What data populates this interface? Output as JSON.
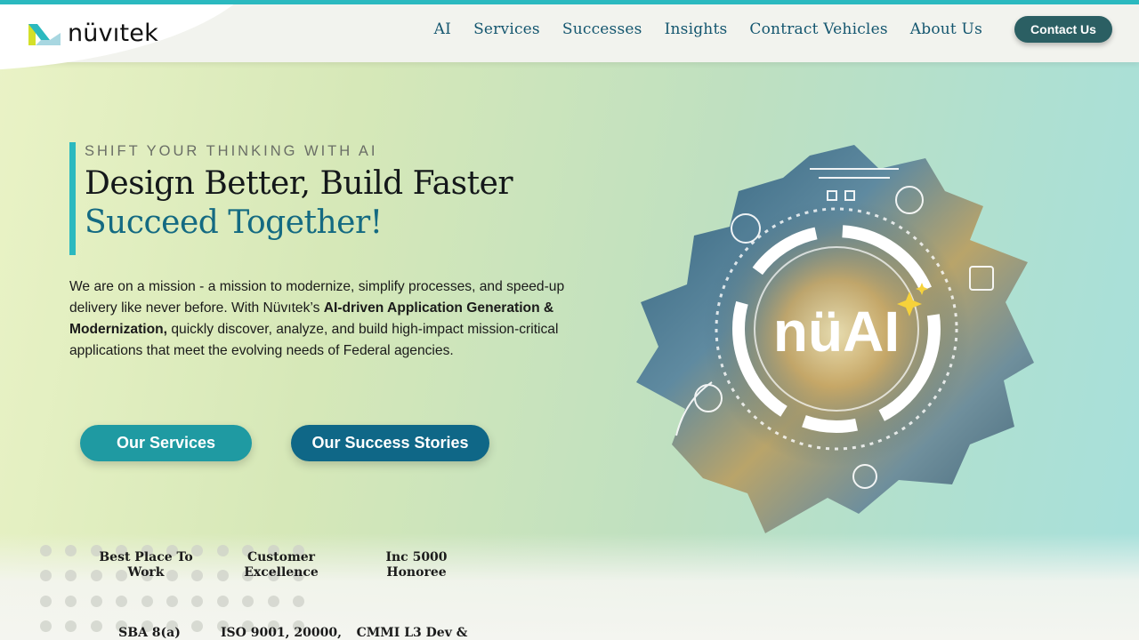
{
  "header": {
    "logo_text": "nüvıtek",
    "nav": [
      "AI",
      "Services",
      "Successes",
      "Insights",
      "Contract Vehicles",
      "About Us"
    ],
    "contact_label": "Contact Us"
  },
  "hero": {
    "eyebrow": "SHIFT YOUR THINKING WITH AI",
    "headline_1": "Design Better, Build Faster",
    "headline_2": "Succeed Together!",
    "mission_1": "We are on a mission - a mission to modernize, simplify processes, and speed-up delivery like never before. With Nüvıtek’s ",
    "mission_bold": "AI-driven Application Generation & Modernization,",
    "mission_2": " quickly discover, analyze, and build high-impact mission-critical applications that meet the evolving needs of Federal agencies.",
    "btn_services": "Our Services",
    "btn_stories": "Our Success Stories",
    "graphic_label": "nüAI"
  },
  "badges": [
    "Best Place To Work",
    "Customer Excellence",
    "Inc 5000 Honoree",
    "SBA 8(a)",
    "ISO 9001, 20000,",
    "CMMI L3 Dev &"
  ],
  "colors": {
    "accent_teal": "#2bb9bf",
    "nav_text": "#14566f",
    "contact_bg": "#2b5f63",
    "services_btn": "#1f9aa2",
    "stories_btn": "#0f6787"
  }
}
